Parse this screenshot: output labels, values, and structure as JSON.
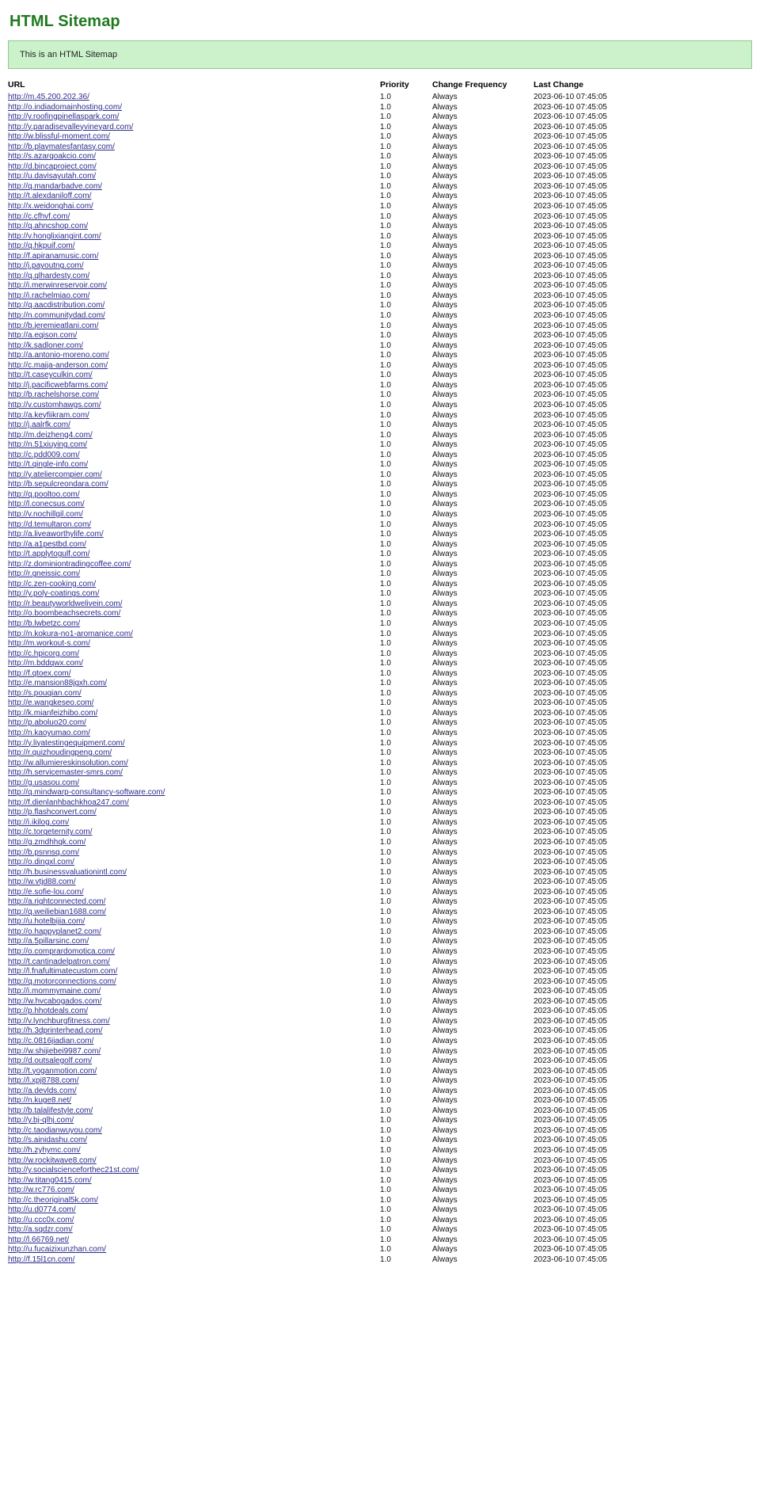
{
  "page": {
    "title": "HTML Sitemap",
    "notice": "This is an HTML Sitemap"
  },
  "table": {
    "headers": {
      "url": "URL",
      "priority": "Priority",
      "change_frequency": "Change Frequency",
      "last_change": "Last Change"
    },
    "default_priority": "1.0",
    "default_frequency": "Always",
    "default_last_change": "2023-06-10 07:45:05",
    "rows": [
      "http://m.45.200.202.36/",
      "http://o.indiadomainhosting.com/",
      "http://y.roofingpinellaspark.com/",
      "http://y.paradisevalleyvineyard.com/",
      "http://w.blissful-moment.com/",
      "http://b.playmatesfantasy.com/",
      "http://s.azarqoakcio.com/",
      "http://d.bincaproject.com/",
      "http://u.davisayutah.com/",
      "http://q.mandarbadve.com/",
      "http://t.alexdaniloff.com/",
      "http://x.weidonghai.com/",
      "http://c.cfhvf.com/",
      "http://q.ahncshop.com/",
      "http://v.honglixiangint.com/",
      "http://q.hkpuif.com/",
      "http://f.apiranamusic.com/",
      "http://j.payoutng.com/",
      "http://q.qlhardesty.com/",
      "http://i.merwinreservoir.com/",
      "http://i.rachelmiao.com/",
      "http://q.aacdistribution.com/",
      "http://n.communitydad.com/",
      "http://b.jeremieatlani.com/",
      "http://a.eqison.com/",
      "http://k.sadloner.com/",
      "http://a.antonio-moreno.com/",
      "http://c.maija-anderson.com/",
      "http://t.caseyculkin.com/",
      "http://j.pacificwebfarms.com/",
      "http://b.rachelshorse.com/",
      "http://v.customhawgs.com/",
      "http://a.keyfiikram.com/",
      "http://j.aalrfk.com/",
      "http://m.deizheng4.com/",
      "http://n.51xiuying.com/",
      "http://c.pdd009.com/",
      "http://t.qingle-info.com/",
      "http://y.ateliercompier.com/",
      "http://b.sepulcreondara.com/",
      "http://q.pooltoo.com/",
      "http://l.conecsus.com/",
      "http://v.nochillgil.com/",
      "http://d.temultaron.com/",
      "http://a.liveaworthylife.com/",
      "http://a.a1pestbd.com/",
      "http://t.applytogulf.com/",
      "http://z.dominiontradingcoffee.com/",
      "http://r.gneissic.com/",
      "http://c.zen-cooking.com/",
      "http://y.poly-coatings.com/",
      "http://r.beautyworldwelivein.com/",
      "http://o.boombeachsecrets.com/",
      "http://b.lwbetzc.com/",
      "http://n.kokura-no1-aromanice.com/",
      "http://m.workout-s.com/",
      "http://c.hpicorg.com/",
      "http://m.bddqwx.com/",
      "http://f.qtoex.com/",
      "http://e.mansion88jgxh.com/",
      "http://s.pouqian.com/",
      "http://e.wangkeseo.com/",
      "http://k.mianfeizhibo.com/",
      "http://p.aboluo20.com/",
      "http://n.kaoyumao.com/",
      "http://y.liyatestingequipment.com/",
      "http://r.quizhoudingpeng.com/",
      "http://w.allumiereskinsolution.com/",
      "http://h.servicemaster-smrs.com/",
      "http://g.usasou.com/",
      "http://q.mindwarp-consultancy-software.com/",
      "http://f.dienlanhbachkhoa247.com/",
      "http://p.flashconvert.com/",
      "http://i.ikilog.com/",
      "http://c.torgeternity.com/",
      "http://g.zmdhhqk.com/",
      "http://b.psnnsq.com/",
      "http://o.dingxl.com/",
      "http://h.businessvaluationintl.com/",
      "http://w.vtjd88.com/",
      "http://e.sofie-lou.com/",
      "http://a.rightconnected.com/",
      "http://q.weiliebian1688.com/",
      "http://u.hotelbijia.com/",
      "http://o.happyplanet2.com/",
      "http://a.5pillarsinc.com/",
      "http://o.comprardomotica.com/",
      "http://t.cantinadelpatron.com/",
      "http://l.fnafultimatecustom.com/",
      "http://q.motorconnections.com/",
      "http://i.mommymaine.com/",
      "http://w.hvcabogados.com/",
      "http://p.hhotdeals.com/",
      "http://v.lynchburgfitness.com/",
      "http://h.3dprinterhead.com/",
      "http://c.0816jiadian.com/",
      "http://w.shijiebei9987.com/",
      "http://d.outsalegolf.com/",
      "http://t.yoganmotion.com/",
      "http://l.xpj8788.com/",
      "http://a.devlds.com/",
      "http://n.kuge8.net/",
      "http://b.talalifestyle.com/",
      "http://y.bj-qlhj.com/",
      "http://c.taodianwuyou.com/",
      "http://s.ainidashu.com/",
      "http://h.zyhymc.com/",
      "http://w.rockitwave8.com/",
      "http://y.socialscienceforthec21st.com/",
      "http://w.titang0415.com/",
      "http://w.rc776.com/",
      "http://c.theoriginal5k.com/",
      "http://u.d0774.com/",
      "http://u.ccc0x.com/",
      "http://a.sqdzr.com/",
      "http://l.66769.net/",
      "http://u.fucaizixunzhan.com/",
      "http://f.15l1cn.com/"
    ]
  }
}
